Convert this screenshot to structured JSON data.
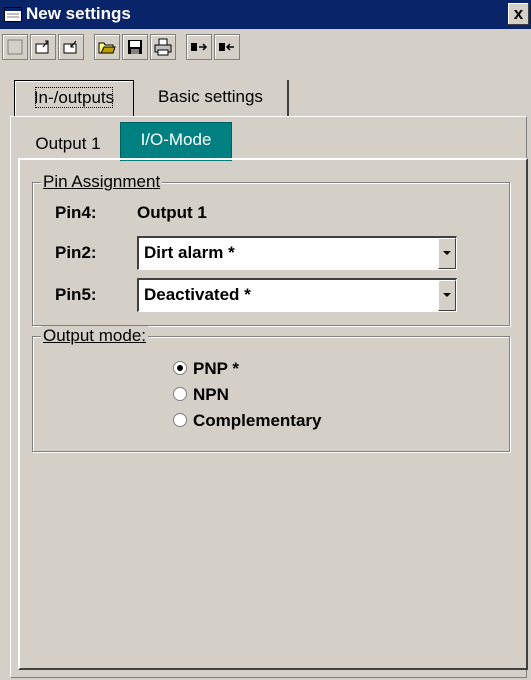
{
  "window": {
    "title": "New settings",
    "close_label": "x"
  },
  "toolbar": {
    "buttons": [
      "new-icon",
      "upload-icon",
      "download-icon",
      "open-icon",
      "save-icon",
      "print-icon",
      "read-device-icon",
      "write-device-icon"
    ]
  },
  "tabs_main": [
    {
      "label": "In-/outputs",
      "active": true
    },
    {
      "label": "Basic settings",
      "active": false
    }
  ],
  "tabs_sub": [
    {
      "label": "Output 1",
      "active": false
    },
    {
      "label": "I/O-Mode",
      "active": true
    }
  ],
  "pin_assignment": {
    "title": "Pin Assignment",
    "rows": [
      {
        "label": "Pin4:",
        "value": "Output 1"
      },
      {
        "label": "Pin2:",
        "value": "Dirt alarm *"
      },
      {
        "label": "Pin5:",
        "value": "Deactivated *"
      }
    ]
  },
  "output_mode": {
    "title": "Output mode:",
    "options": [
      {
        "label": "PNP *",
        "selected": true
      },
      {
        "label": "NPN",
        "selected": false
      },
      {
        "label": "Complementary",
        "selected": false
      }
    ]
  },
  "colors": {
    "titlebar": "#0a246a",
    "active_tab": "#008080",
    "face": "#d4d0c8"
  }
}
